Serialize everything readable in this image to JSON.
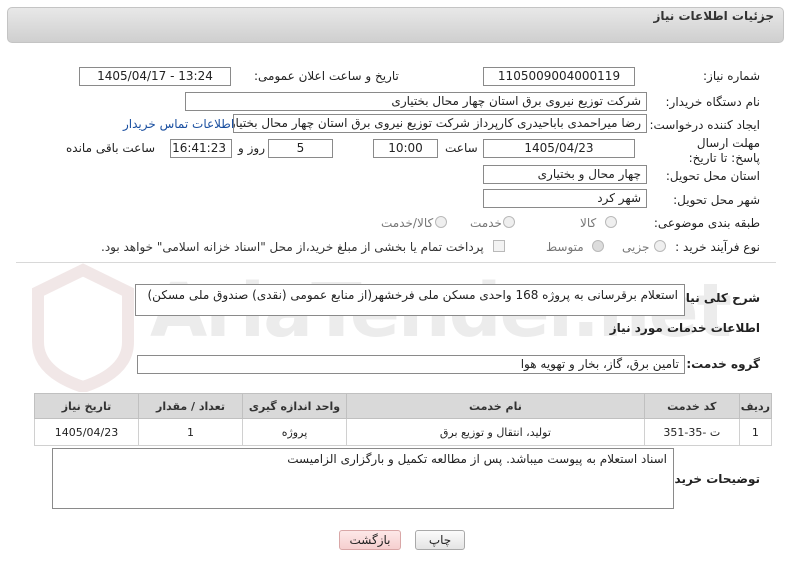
{
  "header": {
    "title": "جزئیات اطلاعات نیاز"
  },
  "labels": {
    "need_number": "شماره نیاز:",
    "announce_datetime": "تاریخ و ساعت اعلان عمومی:",
    "buyer_org": "نام دستگاه خریدار:",
    "requester": "ایجاد کننده درخواست:",
    "deadline": "مهلت ارسال پاسخ: تا تاریخ:",
    "time": "ساعت",
    "day_and": "روز و",
    "hours_remaining": "ساعت باقی مانده",
    "province": "استان محل تحویل:",
    "city": "شهر محل تحویل:",
    "category": "طبقه بندی موضوعی:",
    "process_type": "نوع فرآیند خرید :",
    "description": "شرح کلی نیاز:",
    "services_info": "اطلاعات خدمات مورد نیاز",
    "service_group": "گروه خدمت:",
    "buyer_notes": "توضیحات خریدار:"
  },
  "fields": {
    "need_number": "1105009004000119",
    "announce_datetime": "1405/04/17 - 13:24",
    "buyer_org": "شرکت توزیع نیروی برق استان چهار محال بختیاری",
    "requester": "رضا میراحمدی باباحیدری کارپرداز شرکت توزیع نیروی برق استان چهار محال بختیاری",
    "contact_link": "اطلاعات تماس خریدار",
    "deadline_date": "1405/04/23",
    "deadline_time": "10:00",
    "days": "5",
    "remaining_time": "16:41:23",
    "province": "چهار محال و بختیاری",
    "city": "شهر کرد",
    "description": "استعلام برقرسانی به پروژه 168 واحدی مسکن ملی فرخشهر(از منابع عمومی (نقدی)  صندوق ملی مسکن)",
    "service_group": "تامین برق، گاز، بخار و تهویه هوا",
    "buyer_notes": "اسناد استعلام به پیوست میباشد. پس از مطالعه تکمیل و بارگزاری الزامیست"
  },
  "category_options": [
    "کالا",
    "خدمت",
    "کالا/خدمت"
  ],
  "process_options": [
    "جزیی",
    "متوسط"
  ],
  "payment_note": "پرداخت تمام یا بخشی از مبلغ خرید،از محل \"اسناد خزانه اسلامی\" خواهد بود.",
  "table": {
    "headers": [
      "ردیف",
      "کد خدمت",
      "نام خدمت",
      "واحد اندازه گیری",
      "تعداد / مقدار",
      "تاریخ نیاز"
    ],
    "rows": [
      [
        "1",
        "ت -35-351",
        "تولید، انتقال و توزیع برق",
        "پروژه",
        "1",
        "1405/04/23"
      ]
    ]
  },
  "buttons": {
    "print": "چاپ",
    "back": "بازگشت"
  },
  "watermark": "AriaTender.net"
}
